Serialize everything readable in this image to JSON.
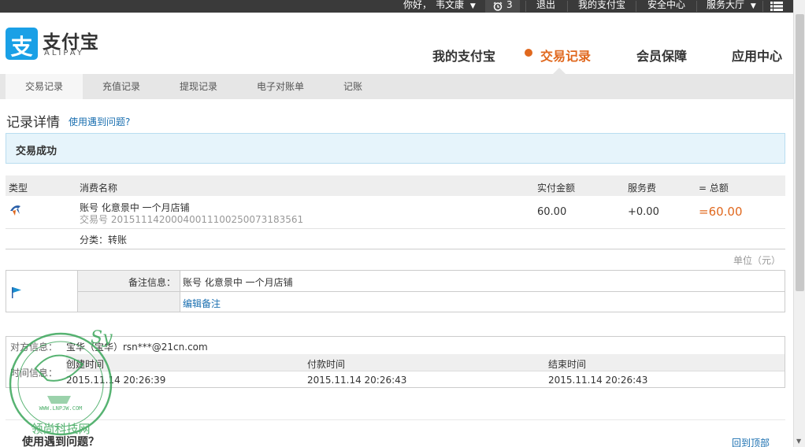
{
  "topbar": {
    "greeting": "你好，",
    "username": "韦文康",
    "username_caret": "▼",
    "notify_count": "3",
    "logout": "退出",
    "my_alipay": "我的支付宝",
    "security": "安全中心",
    "service_hall": "服务大厅",
    "service_caret": "▼"
  },
  "logo": {
    "glyph": "支",
    "cn": "支付宝",
    "en": "ALIPAY"
  },
  "main_nav": [
    {
      "label": "我的支付宝"
    },
    {
      "label": "交易记录"
    },
    {
      "label": "会员保障"
    },
    {
      "label": "应用中心"
    }
  ],
  "sub_nav": [
    {
      "label": "交易记录"
    },
    {
      "label": "充值记录"
    },
    {
      "label": "提现记录"
    },
    {
      "label": "电子对账单"
    },
    {
      "label": "记账"
    }
  ],
  "detail": {
    "title": "记录详情",
    "help_link": "使用遇到问题?",
    "status": "交易成功"
  },
  "table": {
    "headers": [
      "类型",
      "消费名称",
      "实付金额",
      "服务费",
      "= 总额"
    ],
    "row": {
      "name": "账号 化意景中 一个月店铺",
      "trade_no": "交易号 2015111420004001110025007318356​1",
      "paid": "60.00",
      "fee": "+0.00",
      "total": "=60.00"
    },
    "category": "分类：转账",
    "unit": "单位（元）"
  },
  "remark": {
    "label": "备注信息：",
    "value": "账号 化意景中 一个月店铺",
    "edit_link": "编辑备注"
  },
  "party": {
    "label": "对方信息：",
    "value": "宝华（宝华）rsn***@21cn.com",
    "time_label": "时间信息：",
    "created_label": "创建时间",
    "paid_label": "付款时间",
    "ended_label": "结束时间",
    "created": "2015.11.14 20:26:39",
    "paid": "2015.11.14 20:26:43",
    "ended": "2015.11.14 20:26:43"
  },
  "footer": {
    "faq_title": "使用遇到问题？",
    "back_to_top": "回到顶部"
  },
  "watermark": {
    "url_text": "WWW.LNPJW.COM",
    "cn_text": "领尚科技网"
  },
  "colors": {
    "accent": "#e0681e",
    "link": "#1a6fb0",
    "brand": "#1aa0e6",
    "status_bg": "#e6f4fb"
  }
}
